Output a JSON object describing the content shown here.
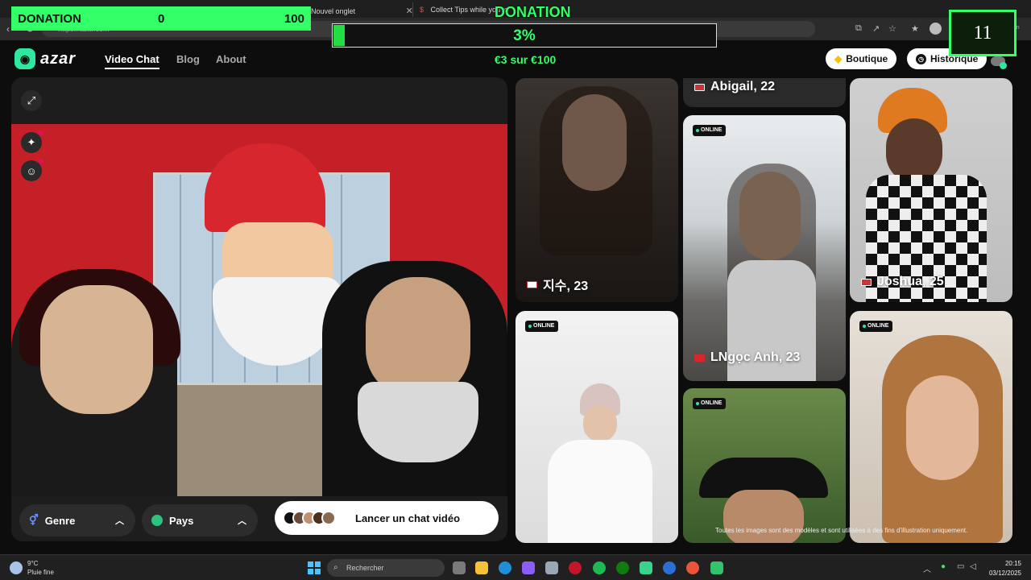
{
  "browser": {
    "tab1_title": "Nouvel onglet",
    "tab2_title": "Collect Tips while you're",
    "url": "https://azar.com",
    "extension_label": "conversation"
  },
  "site": {
    "logo": "azar",
    "nav": [
      "Video Chat",
      "Blog",
      "About"
    ],
    "boutique_label": "Boutique",
    "historique_label": "Historique"
  },
  "controls": {
    "genre_label": "Genre",
    "pays_label": "Pays",
    "launch_label": "Lancer un chat vidéo"
  },
  "cards": {
    "jisu": {
      "name": "지수, 23",
      "flag": "south-korea-flag"
    },
    "abigail": {
      "name": "Abigail, 22",
      "flag": "usa-flag"
    },
    "lngoc": {
      "name": "LNgọc Anh, 23",
      "flag": "vietnam-flag"
    },
    "joshua": {
      "name": "Joshua, 25",
      "flag": "usa-flag"
    },
    "online_label": "ONLINE"
  },
  "footnote": "Toutes les images sont des modèles et sont utilisées à des fins d'illustration uniquement.",
  "overlay": {
    "donation_box_label": "DONATION",
    "donation_min": "0",
    "donation_max": "100",
    "donation_title": "DONATION",
    "progress_percent_text": "3%",
    "progress_fraction": 0.03,
    "progress_sub": "€3 sur €100",
    "counter": "11"
  },
  "taskbar": {
    "temperature": "9°C",
    "weather": "Pluie fine",
    "search_placeholder": "Rechercher",
    "time": "20:15",
    "date": "03/12/2025"
  },
  "colors": {
    "accent": "#2ee89f",
    "overlay_green": "#33ff66"
  }
}
